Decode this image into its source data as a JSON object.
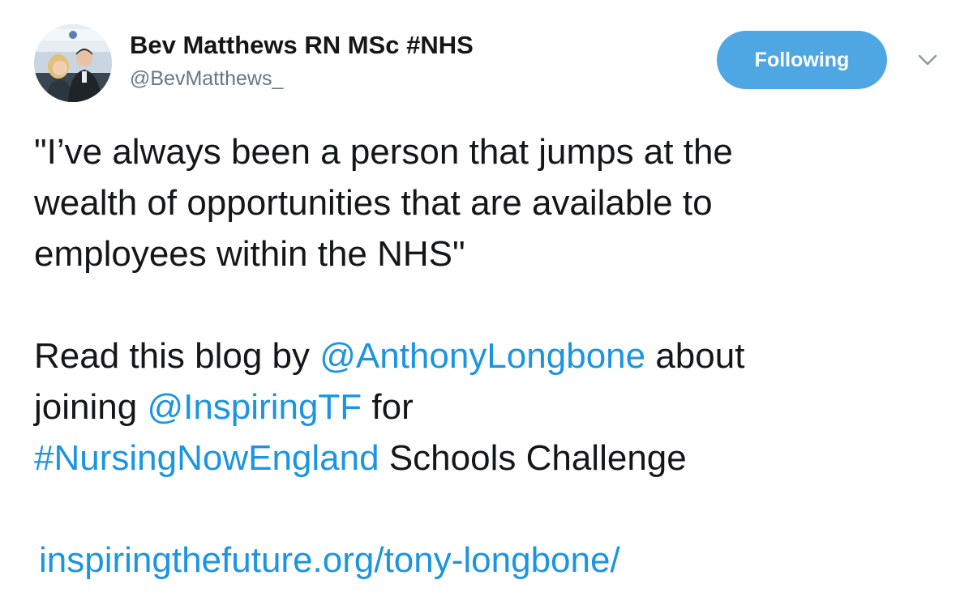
{
  "author": {
    "display_name": "Bev Matthews RN MSc #NHS",
    "screen_name": "@BevMatthews_",
    "avatar_icon": "profile-photo"
  },
  "follow_button": {
    "label": "Following",
    "color": "#4ea7e3"
  },
  "menu": {
    "icon": "chevron-down-icon"
  },
  "tweet": {
    "quote_line1": "\"I’ve always been a person that jumps at the",
    "quote_line2": "wealth of opportunities that are available to",
    "quote_line3": "employees within the NHS\"",
    "p2_text1": "Read this blog by ",
    "mention1": "@AnthonyLongbone",
    "p2_text2": " about",
    "p2_text3": "joining ",
    "mention2": "@InspiringTF",
    "p2_text4": " for",
    "hashtag": "#NursingNowEngland",
    "p2_text5": " Schools Challenge",
    "url": "inspiringthefuture.org/tony-longbone/"
  },
  "colors": {
    "link": "#1b95e0",
    "text": "#14171a",
    "secondary": "#657786"
  }
}
